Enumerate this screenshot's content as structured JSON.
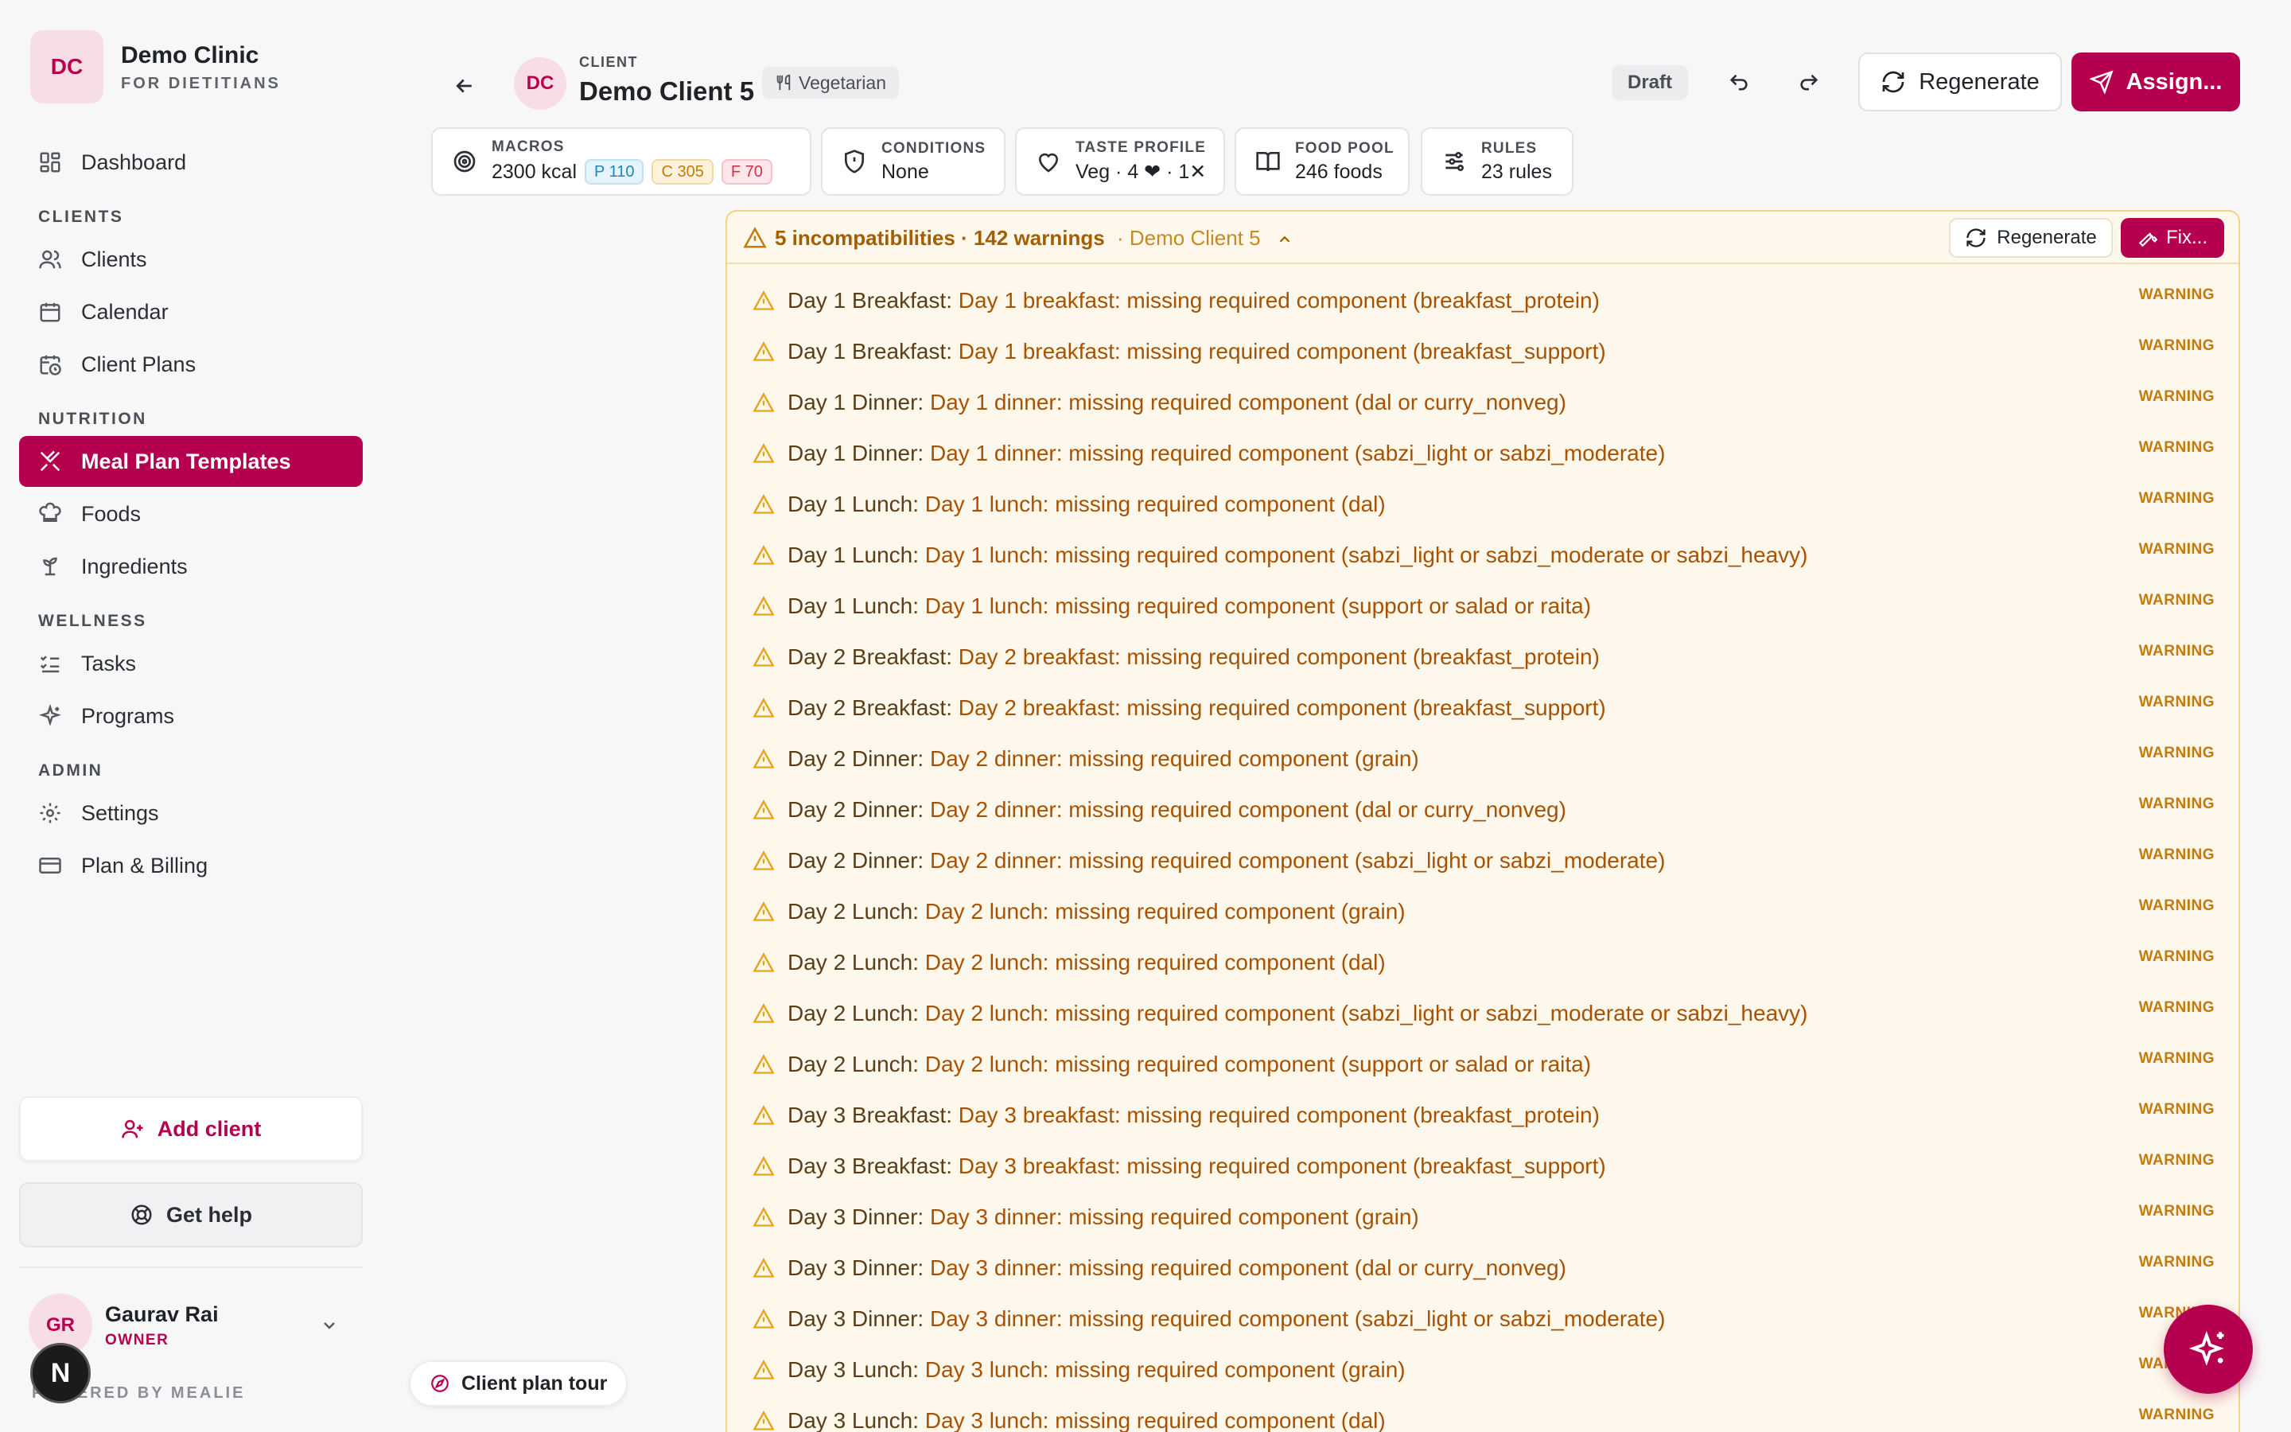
{
  "brand": {
    "avatar": "DC",
    "name": "Demo Clinic",
    "subtitle": "FOR DIETITIANS"
  },
  "nav": {
    "dashboard": "Dashboard",
    "section_clients": "CLIENTS",
    "clients": "Clients",
    "calendar": "Calendar",
    "client_plans": "Client Plans",
    "section_nutrition": "NUTRITION",
    "meal_plan_templates": "Meal Plan Templates",
    "foods": "Foods",
    "ingredients": "Ingredients",
    "section_wellness": "WELLNESS",
    "tasks": "Tasks",
    "programs": "Programs",
    "section_admin": "ADMIN",
    "settings": "Settings",
    "plan_billing": "Plan & Billing"
  },
  "sidebar_actions": {
    "add_client": "Add client",
    "get_help": "Get help"
  },
  "user": {
    "avatar": "GR",
    "name": "Gaurav Rai",
    "role": "OWNER",
    "powered_by": "POWERED BY MEALIE",
    "n_badge": "N"
  },
  "header": {
    "client_avatar": "DC",
    "client_label": "CLIENT",
    "client_name": "Demo Client 5",
    "diet_badge": "Vegetarian",
    "status": "Draft",
    "regenerate": "Regenerate",
    "assign": "Assign..."
  },
  "cards": {
    "macros": {
      "label": "MACROS",
      "kcal": "2300 kcal",
      "protein": "P 110",
      "carbs": "C 305",
      "fat": "F 70"
    },
    "conditions": {
      "label": "CONDITIONS",
      "value": "None"
    },
    "taste_profile": {
      "label": "TASTE PROFILE",
      "value": "Veg · 4 ❤ · 1✕"
    },
    "food_pool": {
      "label": "FOOD POOL",
      "value": "246 foods"
    },
    "rules": {
      "label": "RULES",
      "value": "23 rules"
    }
  },
  "warnings_panel": {
    "title": "5 incompatibilities · 142 warnings",
    "subtitle": "· Demo Client 5",
    "regenerate": "Regenerate",
    "fix": "Fix...",
    "items": [
      {
        "meal": "Day 1 Breakfast:",
        "message": "Day 1 breakfast: missing required component (breakfast_protein)",
        "level": "WARNING"
      },
      {
        "meal": "Day 1 Breakfast:",
        "message": "Day 1 breakfast: missing required component (breakfast_support)",
        "level": "WARNING"
      },
      {
        "meal": "Day 1 Dinner:",
        "message": "Day 1 dinner: missing required component (dal or curry_nonveg)",
        "level": "WARNING"
      },
      {
        "meal": "Day 1 Dinner:",
        "message": "Day 1 dinner: missing required component (sabzi_light or sabzi_moderate)",
        "level": "WARNING"
      },
      {
        "meal": "Day 1 Lunch:",
        "message": "Day 1 lunch: missing required component (dal)",
        "level": "WARNING"
      },
      {
        "meal": "Day 1 Lunch:",
        "message": "Day 1 lunch: missing required component (sabzi_light or sabzi_moderate or sabzi_heavy)",
        "level": "WARNING"
      },
      {
        "meal": "Day 1 Lunch:",
        "message": "Day 1 lunch: missing required component (support or salad or raita)",
        "level": "WARNING"
      },
      {
        "meal": "Day 2 Breakfast:",
        "message": "Day 2 breakfast: missing required component (breakfast_protein)",
        "level": "WARNING"
      },
      {
        "meal": "Day 2 Breakfast:",
        "message": "Day 2 breakfast: missing required component (breakfast_support)",
        "level": "WARNING"
      },
      {
        "meal": "Day 2 Dinner:",
        "message": "Day 2 dinner: missing required component (grain)",
        "level": "WARNING"
      },
      {
        "meal": "Day 2 Dinner:",
        "message": "Day 2 dinner: missing required component (dal or curry_nonveg)",
        "level": "WARNING"
      },
      {
        "meal": "Day 2 Dinner:",
        "message": "Day 2 dinner: missing required component (sabzi_light or sabzi_moderate)",
        "level": "WARNING"
      },
      {
        "meal": "Day 2 Lunch:",
        "message": "Day 2 lunch: missing required component (grain)",
        "level": "WARNING"
      },
      {
        "meal": "Day 2 Lunch:",
        "message": "Day 2 lunch: missing required component (dal)",
        "level": "WARNING"
      },
      {
        "meal": "Day 2 Lunch:",
        "message": "Day 2 lunch: missing required component (sabzi_light or sabzi_moderate or sabzi_heavy)",
        "level": "WARNING"
      },
      {
        "meal": "Day 2 Lunch:",
        "message": "Day 2 lunch: missing required component (support or salad or raita)",
        "level": "WARNING"
      },
      {
        "meal": "Day 3 Breakfast:",
        "message": "Day 3 breakfast: missing required component (breakfast_protein)",
        "level": "WARNING"
      },
      {
        "meal": "Day 3 Breakfast:",
        "message": "Day 3 breakfast: missing required component (breakfast_support)",
        "level": "WARNING"
      },
      {
        "meal": "Day 3 Dinner:",
        "message": "Day 3 dinner: missing required component (grain)",
        "level": "WARNING"
      },
      {
        "meal": "Day 3 Dinner:",
        "message": "Day 3 dinner: missing required component (dal or curry_nonveg)",
        "level": "WARNING"
      },
      {
        "meal": "Day 3 Dinner:",
        "message": "Day 3 dinner: missing required component (sabzi_light or sabzi_moderate)",
        "level": "WARNING"
      },
      {
        "meal": "Day 3 Lunch:",
        "message": "Day 3 lunch: missing required component (grain)",
        "level": "WARNING"
      },
      {
        "meal": "Day 3 Lunch:",
        "message": "Day 3 lunch: missing required component (dal)",
        "level": "WARNING"
      }
    ]
  },
  "floating": {
    "tour": "Client plan tour"
  },
  "colors": {
    "brand": "#b5004f",
    "warning_text": "#a85200",
    "warning_icon": "#e8a21c",
    "panel_bg": "#fdf8eb"
  }
}
